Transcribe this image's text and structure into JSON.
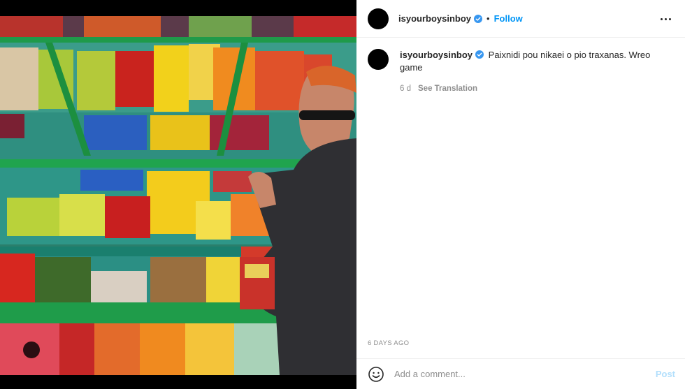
{
  "post": {
    "username": "isyourboysinboy",
    "dot": "•",
    "follow_label": "Follow",
    "caption_text": "Paixnidi pou nikaei o pio traxanas. Wreo game",
    "caption_age": "6 d",
    "see_translation": "See Translation",
    "posted_ago": "6 DAYS AGO"
  },
  "comment": {
    "placeholder": "Add a comment...",
    "post_label": "Post"
  },
  "icons": {
    "verified": "verified-badge-icon",
    "more": "more-options-icon",
    "emoji": "emoji-icon"
  },
  "colors": {
    "accent": "#0095f6",
    "post_disabled": "#b2dffc",
    "muted": "#8e8e8e",
    "verified": "#3897f0"
  }
}
